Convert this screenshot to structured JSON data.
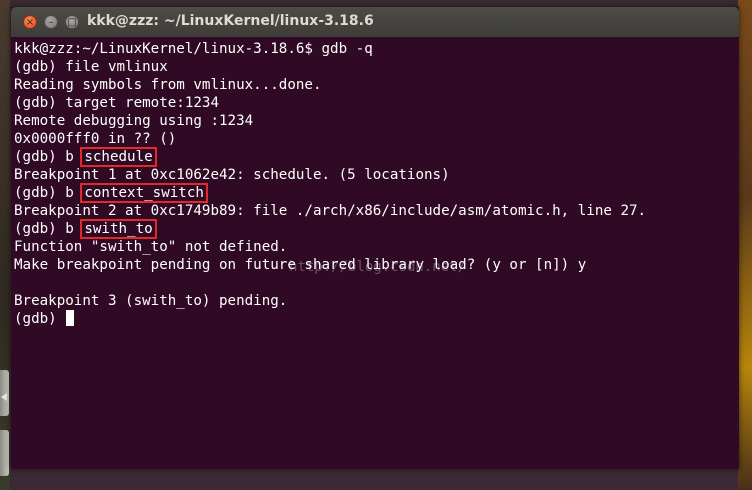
{
  "window": {
    "title": "kkk@zzz: ~/LinuxKernel/linux-3.18.6",
    "close_glyph": "×",
    "minimize_glyph": "–",
    "maximize_glyph": "□"
  },
  "terminal": {
    "lines": [
      {
        "text": "kkk@zzz:~/LinuxKernel/linux-3.18.6$ gdb -q"
      },
      {
        "text": "(gdb) file vmlinux"
      },
      {
        "text": "Reading symbols from vmlinux...done."
      },
      {
        "text": "(gdb) target remote:1234"
      },
      {
        "text": "Remote debugging using :1234"
      },
      {
        "text": "0x0000fff0 in ?? ()"
      },
      {
        "prefix": "(gdb) b ",
        "highlight": "schedule"
      },
      {
        "text": "Breakpoint 1 at 0xc1062e42: schedule. (5 locations)"
      },
      {
        "prefix": "(gdb) b ",
        "highlight": "context_switch"
      },
      {
        "text": "Breakpoint 2 at 0xc1749b89: file ./arch/x86/include/asm/atomic.h, line 27."
      },
      {
        "prefix": "(gdb) b ",
        "highlight": "swith_to"
      },
      {
        "text": "Function \"swith_to\" not defined."
      },
      {
        "text": "Make breakpoint pending on future shared library load? (y or [n]) y"
      },
      {
        "text": ""
      },
      {
        "text": "Breakpoint 3 (swith_to) pending."
      },
      {
        "prompt": "(gdb) "
      }
    ]
  },
  "watermark": "http://blog.csdn.net/",
  "colors": {
    "terminal_bg": "#300a24",
    "text": "#ffffff",
    "highlight_box": "#e02a2a",
    "close_button": "#df4a16"
  }
}
